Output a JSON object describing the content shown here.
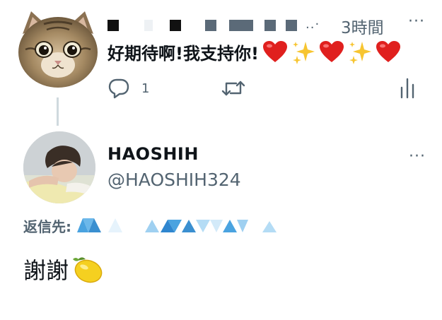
{
  "parent_tweet": {
    "time": "3時間",
    "text": "好期待啊!我支持你!",
    "reply_count": "1",
    "emoji_icons": [
      "heart-icon",
      "sparkles-icon",
      "heart-icon",
      "sparkles-icon",
      "heart-icon"
    ],
    "avatar_icon": "cat-avatar"
  },
  "reply_tweet": {
    "display_name": "HAOSHIH",
    "handle": "@HAOSHIH324",
    "replying_to_label": "返信先:",
    "text": "謝謝",
    "emoji_icon": "lemon-icon"
  },
  "colors": {
    "text_primary": "#0f1419",
    "text_secondary": "#536471",
    "thread_line": "#cfd9de",
    "heart": "#e0201e",
    "sparkle": "#f7c531"
  }
}
